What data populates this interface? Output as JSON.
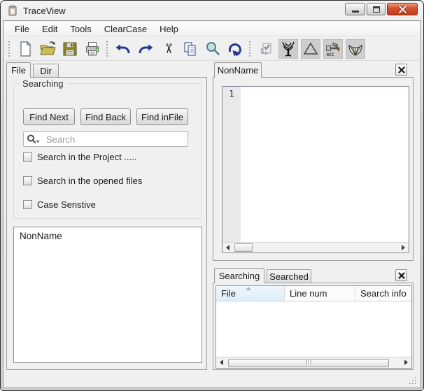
{
  "window": {
    "title": "TraceView",
    "icon": "clipboard-icon",
    "controls": [
      "minimize",
      "maximize",
      "close"
    ]
  },
  "menubar": {
    "items": [
      "File",
      "Edit",
      "Tools",
      "ClearCase",
      "Help"
    ]
  },
  "toolbar": {
    "groups": [
      {
        "icons": [
          "new-document",
          "open-folder",
          "save",
          "print"
        ]
      },
      {
        "icons": [
          "undo",
          "redo",
          "cut",
          "copy",
          "find",
          "repeat"
        ]
      },
      {
        "icons": [
          "sync-check-disabled",
          "tree",
          "triangle",
          "gcc-build",
          "shell"
        ]
      }
    ]
  },
  "left_panel": {
    "tabs": [
      {
        "label": "File",
        "active": true
      },
      {
        "label": "Dir",
        "active": false
      }
    ],
    "search_group": {
      "title": "Searching",
      "buttons": [
        {
          "label": "Find Next"
        },
        {
          "label": "Find Back"
        },
        {
          "label": "Find inFile"
        }
      ],
      "search": {
        "placeholder": "Search",
        "value": ""
      },
      "checkboxes": [
        {
          "label": "Search in the Project .....",
          "checked": false
        },
        {
          "label": "Search in the opened files",
          "checked": false
        },
        {
          "label": "Case Senstive",
          "checked": false
        }
      ]
    },
    "file_list": {
      "items": [
        "NonName"
      ]
    }
  },
  "editor_panel": {
    "tabs": [
      {
        "label": "NonName",
        "active": true
      }
    ],
    "line_numbers": [
      "1"
    ],
    "content": ""
  },
  "results_panel": {
    "tabs": [
      {
        "label": "Searching",
        "active": true
      },
      {
        "label": "Searched",
        "active": false
      }
    ],
    "table": {
      "columns": [
        "File",
        "Line num",
        "Search info"
      ],
      "sort_column": "File",
      "sort_direction": "ascending",
      "rows": []
    }
  },
  "colors": {
    "titlebar_silver": "#d8d8d8",
    "close_button_red": "#c84a2c",
    "panel_background": "#f0f0f0",
    "toolbar_icon_navy": "#283593",
    "magnifier_teal": "#bfe3e0",
    "sorted_header_blue": "#e4f1fb",
    "save_folder_olive": "#8f8c2a",
    "editor_gutter_gray": "#e9e9e9"
  }
}
